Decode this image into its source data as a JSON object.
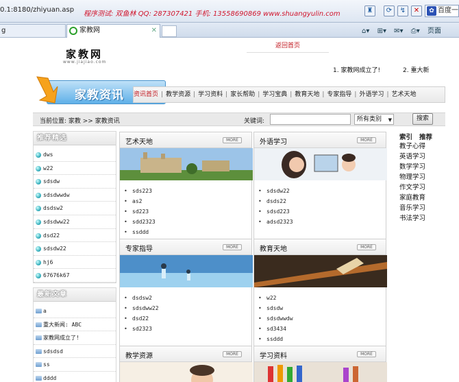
{
  "browser": {
    "url": "0.1:8180/zhiyuan.asp",
    "marquee": "程序测试: 双鱼林  QQ: 287307421  手机: 13558690869  www.shuangyulin.com",
    "search_engine": "百度一",
    "tab_prev_label": "g",
    "tab_active_label": "家教网",
    "toolbar_page_label": "页面"
  },
  "header": {
    "logo": "家教网",
    "logo_sub": "www.jiajiao.com",
    "back_home": "返回首页",
    "news_ticker": [
      "1. 家教网成立了!",
      "2. 重大新"
    ]
  },
  "banner": {
    "title": "家教资讯",
    "nav": [
      "资讯首页",
      "教学资源",
      "学习资料",
      "家长帮助",
      "学习宝典",
      "教育天地",
      "专家指导",
      "外语学习",
      "艺术天地"
    ]
  },
  "location": {
    "text": "当前位置: 家教 >> 家教资讯",
    "keyword_label": "关键词:",
    "keyword_value": "",
    "category_selected": "所有类别",
    "search_button": "搜索"
  },
  "sidebar_recommend": {
    "title": "推荐精选",
    "items": [
      "dws",
      "w22",
      "sdsdw",
      "sdsdwwdw",
      "dsdsw2",
      "sdsdww22",
      "dsd22",
      "sdsdw22",
      "hj6",
      "67676k67"
    ]
  },
  "sidebar_latest": {
    "title": "最新文章",
    "items": [
      "a",
      "重大新闻: ABC",
      "家教网成立了!",
      "sdsdsd",
      "ss",
      "dddd"
    ]
  },
  "panels": {
    "art": {
      "title": "艺术天地",
      "more": "MORE",
      "items": [
        "sds223",
        "as2",
        "sd223",
        "sdd2323",
        "ssddd"
      ]
    },
    "lang": {
      "title": "外语学习",
      "more": "MORE",
      "items": [
        "sdsdw22",
        "dsds22",
        "sdsd223",
        "adsd2323"
      ]
    },
    "expert": {
      "title": "专家指导",
      "more": "MORE",
      "items": [
        "dsdsw2",
        "sdsdww22",
        "dsd22",
        "sd2323"
      ]
    },
    "edu": {
      "title": "教育天地",
      "more": "MORE",
      "items": [
        "w22",
        "sdsdw",
        "sdsdwwdw",
        "sd3434",
        "ssddd"
      ]
    },
    "teach": {
      "title": "教学资源",
      "more": "MORE",
      "items": []
    },
    "study": {
      "title": "学习资料",
      "more": "MORE",
      "items": []
    }
  },
  "index": {
    "head": [
      "索引",
      "推荐"
    ],
    "items": [
      "教子心得",
      "英语学习",
      "数学学习",
      "物理学习",
      "作文学习",
      "家庭教育",
      "音乐学习",
      "书法学习"
    ]
  }
}
